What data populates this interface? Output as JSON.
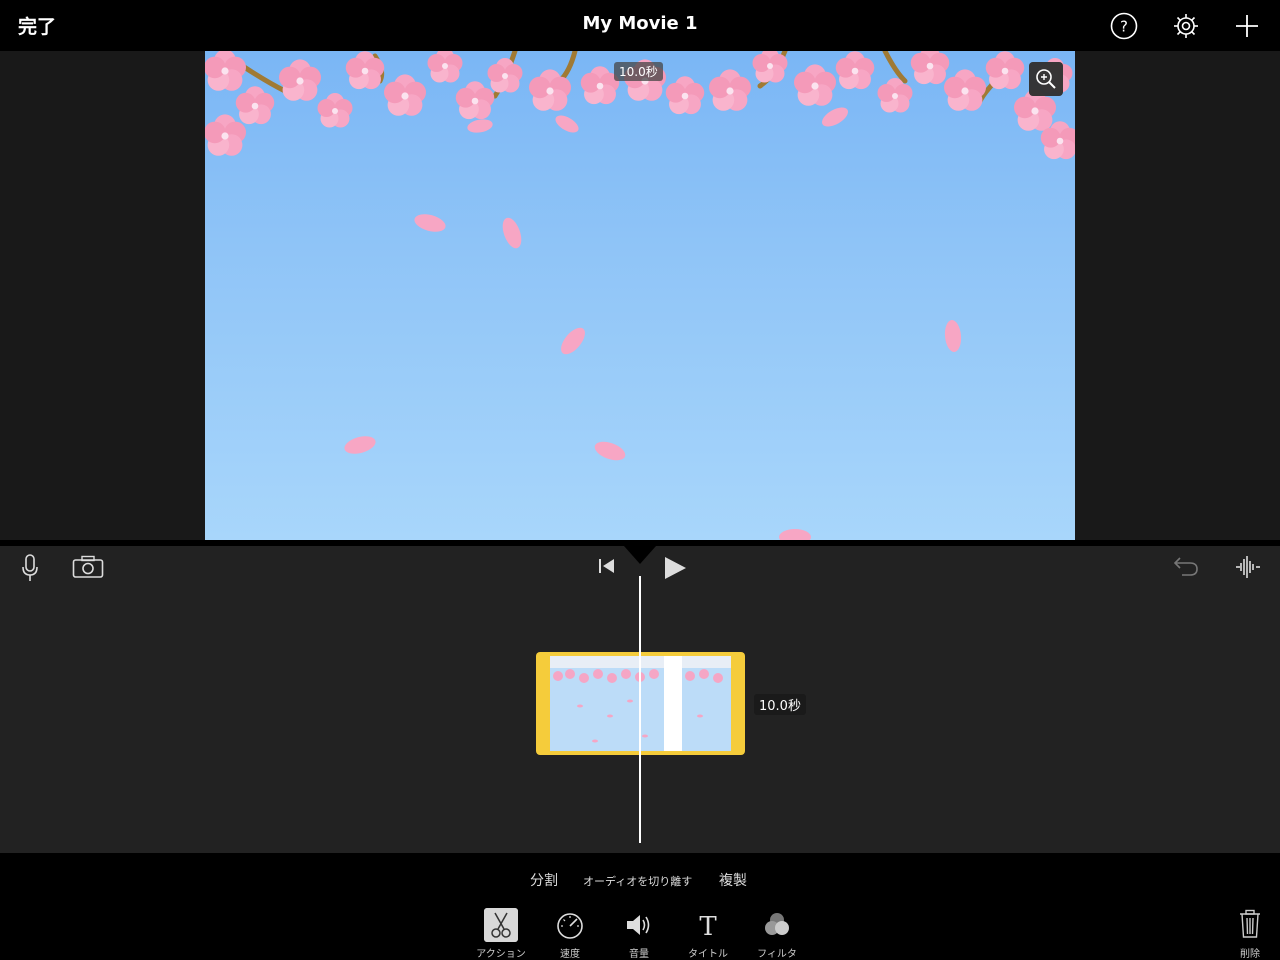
{
  "header": {
    "done_label": "完了",
    "title": "My Movie 1",
    "icons": [
      "help-icon",
      "settings-icon",
      "add-icon"
    ]
  },
  "viewer": {
    "duration_overlay": "10.0秒",
    "zoom_icon": "zoom-in-icon",
    "background_colors": [
      "#7ab6f5",
      "#a8d6fb"
    ],
    "petal_color": "#f7a6c4"
  },
  "timeline": {
    "left_icons": [
      "microphone-icon",
      "camera-icon"
    ],
    "center_icons": [
      "skip-to-start-icon",
      "play-icon"
    ],
    "right_icons": [
      "undo-icon",
      "audio-waveform-icon"
    ],
    "clip_duration": "10.0秒",
    "clip_border_color": "#f5cc3b"
  },
  "actions": {
    "split": "分割",
    "detach_audio": "オーディオを切り離す",
    "duplicate": "複製"
  },
  "tools": [
    {
      "label": "アクション",
      "icon": "scissors-icon",
      "active": true
    },
    {
      "label": "速度",
      "icon": "speedometer-icon",
      "active": false
    },
    {
      "label": "音量",
      "icon": "volume-icon",
      "active": false
    },
    {
      "label": "タイトル",
      "icon": "title-icon",
      "active": false
    },
    {
      "label": "フィルタ",
      "icon": "filter-icon",
      "active": false
    }
  ],
  "delete_label": "削除"
}
